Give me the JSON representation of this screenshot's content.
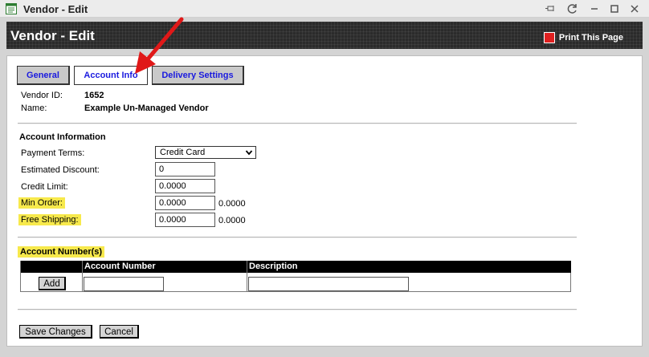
{
  "window": {
    "title": "Vendor - Edit"
  },
  "header": {
    "title": "Vendor - Edit",
    "print_label": "Print This Page"
  },
  "tabs": [
    {
      "label": "General",
      "active": false
    },
    {
      "label": "Account Info",
      "active": true
    },
    {
      "label": "Delivery Settings",
      "active": false
    }
  ],
  "vendor": {
    "id_label": "Vendor ID:",
    "id_value": "1652",
    "name_label": "Name:",
    "name_value": "Example Un-Managed Vendor"
  },
  "account_info": {
    "section_title": "Account Information",
    "payment_terms_label": "Payment Terms:",
    "payment_terms_value": "Credit Card",
    "est_discount_label": "Estimated Discount:",
    "est_discount_value": "0",
    "credit_limit_label": "Credit Limit:",
    "credit_limit_value": "0.0000",
    "min_order_label": "Min Order:",
    "min_order_value": "0.0000",
    "min_order_suffix": "0.0000",
    "free_shipping_label": "Free Shipping:",
    "free_shipping_value": "0.0000",
    "free_shipping_suffix": "0.0000"
  },
  "account_numbers": {
    "section_title": "Account Number(s)",
    "col_account_number": "Account Number",
    "col_description": "Description",
    "add_label": "Add",
    "account_number_value": "",
    "description_value": ""
  },
  "actions": {
    "save_label": "Save Changes",
    "cancel_label": "Cancel"
  },
  "colors": {
    "highlight": "#f7e94c",
    "tab_link": "#1a1adf",
    "header_bg": "#2b2b2b",
    "annotation_arrow": "#e01818"
  }
}
